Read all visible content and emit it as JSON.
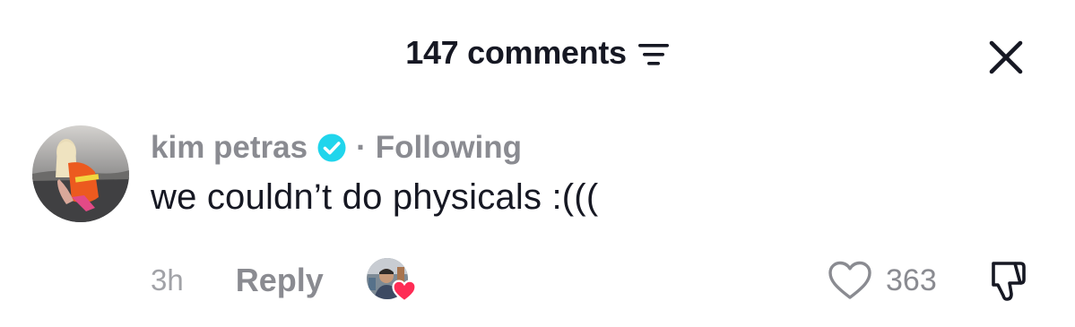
{
  "header": {
    "comments_count_label": "147 comments",
    "sort_icon": "sort-lines-icon",
    "close_icon": "close-icon"
  },
  "comment": {
    "username": "kim petras",
    "verified_icon": "verified-badge-icon",
    "separator": "·",
    "follow_status": "Following",
    "text": "we couldn’t do physicals :(((",
    "timestamp": "3h",
    "reply_label": "Reply",
    "like_count": "363",
    "like_icon": "heart-outline-icon",
    "dislike_icon": "thumbs-down-icon",
    "creator_liked_icon": "creator-liked-heart-icon"
  },
  "colors": {
    "verified_blue": "#20d5ec",
    "creator_heart": "#fe2c55",
    "secondary_text": "#8a8b91",
    "primary_text": "#161823"
  }
}
